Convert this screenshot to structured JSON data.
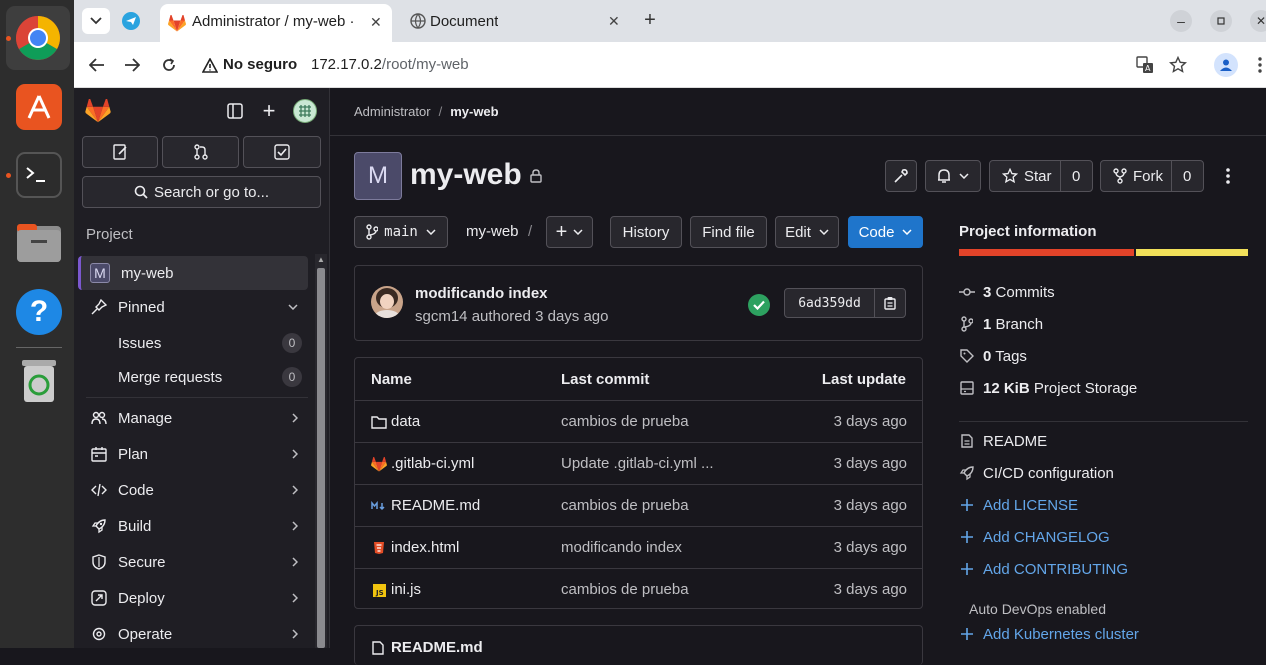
{
  "browser": {
    "tabs": [
      {
        "label": "Administrator / my-web ·"
      },
      {
        "label": "Document"
      }
    ],
    "security_label": "No seguro",
    "url_host": "172.17.0.2",
    "url_path": "/root/my-web"
  },
  "sidebar": {
    "section_title": "Project",
    "search_label": "Search or go to...",
    "project_initial": "M",
    "project_name": "my-web",
    "pinned_label": "Pinned",
    "pinned_items": [
      {
        "label": "Issues",
        "count": "0"
      },
      {
        "label": "Merge requests",
        "count": "0"
      }
    ],
    "nav_items": [
      {
        "label": "Manage",
        "icon": "users-icon"
      },
      {
        "label": "Plan",
        "icon": "calendar-icon"
      },
      {
        "label": "Code",
        "icon": "code-icon"
      },
      {
        "label": "Build",
        "icon": "rocket-icon"
      },
      {
        "label": "Secure",
        "icon": "shield-icon"
      },
      {
        "label": "Deploy",
        "icon": "deploy-icon"
      },
      {
        "label": "Operate",
        "icon": "cloud-gear-icon"
      }
    ]
  },
  "breadcrumb": {
    "parent": "Administrator",
    "separator": "/",
    "current": "my-web"
  },
  "project": {
    "avatar_initial": "M",
    "title": "my-web",
    "star_label": "Star",
    "star_count": "0",
    "fork_label": "Fork",
    "fork_count": "0"
  },
  "repo_toolbar": {
    "branch": "main",
    "path": "my-web",
    "path_sep": "/",
    "history": "History",
    "find_file": "Find file",
    "edit": "Edit",
    "code": "Code"
  },
  "last_commit": {
    "title": "modificando index",
    "author": "sgcm14",
    "authored_text": "authored 3 days ago",
    "sha": "6ad359dd"
  },
  "file_table": {
    "headers": {
      "name": "Name",
      "last_commit": "Last commit",
      "last_update": "Last update"
    },
    "rows": [
      {
        "name": "data",
        "commit": "cambios de prueba",
        "updated": "3 days ago",
        "icon": "folder-icon"
      },
      {
        "name": ".gitlab-ci.yml",
        "commit": "Update .gitlab-ci.yml ...",
        "updated": "3 days ago",
        "icon": "gitlab-file-icon"
      },
      {
        "name": "README.md",
        "commit": "cambios de prueba",
        "updated": "3 days ago",
        "icon": "markdown-icon"
      },
      {
        "name": "index.html",
        "commit": "modificando index",
        "updated": "3 days ago",
        "icon": "html-icon"
      },
      {
        "name": "ini.js",
        "commit": "cambios de prueba",
        "updated": "3 days ago",
        "icon": "js-icon"
      }
    ]
  },
  "readme_card": {
    "title": "README.md"
  },
  "project_info": {
    "title": "Project information",
    "stats": [
      {
        "value": "3",
        "label": "Commits",
        "icon": "commit-icon"
      },
      {
        "value": "1",
        "label": "Branch",
        "icon": "branch-icon"
      },
      {
        "value": "0",
        "label": "Tags",
        "icon": "tag-icon"
      },
      {
        "value": "12 KiB",
        "label": "Project Storage",
        "icon": "storage-icon"
      }
    ],
    "links": [
      {
        "label": "README",
        "icon": "doc-icon"
      },
      {
        "label": "CI/CD configuration",
        "icon": "rocket-icon"
      }
    ],
    "add_links": [
      "Add LICENSE",
      "Add CHANGELOG",
      "Add CONTRIBUTING"
    ],
    "auto_devops": "Auto DevOps enabled",
    "add_k8s": "Add Kubernetes cluster"
  },
  "colors": {
    "accent_blue": "#1f75cb",
    "language_bar_orange": "#e24329",
    "language_bar_yellow": "#f1e05a",
    "pipeline_success": "#2da160"
  }
}
